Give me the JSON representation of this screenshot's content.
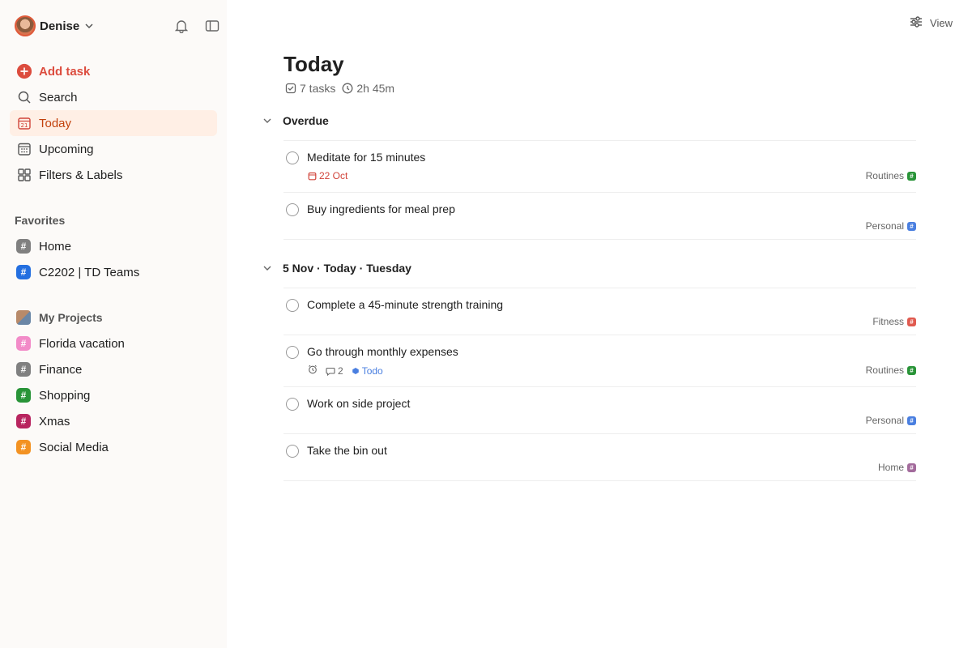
{
  "user": {
    "name": "Denise"
  },
  "nav": [
    {
      "key": "add",
      "label": "Add task",
      "icon": "plus-circle-icon"
    },
    {
      "key": "search",
      "label": "Search",
      "icon": "search-icon"
    },
    {
      "key": "today",
      "label": "Today",
      "icon": "calendar-today-icon",
      "badge": "21"
    },
    {
      "key": "upcoming",
      "label": "Upcoming",
      "icon": "calendar-grid-icon"
    },
    {
      "key": "filters",
      "label": "Filters & Labels",
      "icon": "grid-icon"
    }
  ],
  "favorites": {
    "label": "Favorites",
    "items": [
      {
        "label": "Home",
        "color": "#808080"
      },
      {
        "label": "C2202 | TD Teams",
        "color": "#246fe0"
      }
    ]
  },
  "projects": {
    "label": "My Projects",
    "items": [
      {
        "label": "Florida vacation",
        "color": "#f28bc8"
      },
      {
        "label": "Finance",
        "color": "#808080"
      },
      {
        "label": "Shopping",
        "color": "#299438"
      },
      {
        "label": "Xmas",
        "color": "#b8255f"
      },
      {
        "label": "Social Media",
        "color": "#f39222"
      }
    ]
  },
  "header": {
    "view_label": "View",
    "title": "Today",
    "task_count": "7 tasks",
    "duration": "2h 45m"
  },
  "groups": [
    {
      "title": "Overdue"
    },
    {
      "title": "5 Nov · Today · Tuesday"
    }
  ],
  "tasks": [
    {
      "title": "Meditate for 15 minutes",
      "due": "22 Oct",
      "project": "Routines",
      "project_color": "#299438"
    },
    {
      "title": "Buy ingredients for meal prep",
      "project": "Personal",
      "project_color": "#4a7fe0"
    },
    {
      "title": "Complete a 45-minute strength training",
      "project": "Fitness",
      "project_color": "#e05a4f"
    },
    {
      "title": "Go through monthly expenses",
      "comments": "2",
      "label": "Todo",
      "project": "Routines",
      "project_color": "#299438"
    },
    {
      "title": "Work on side project",
      "project": "Personal",
      "project_color": "#4a7fe0"
    },
    {
      "title": "Take the bin out",
      "project": "Home",
      "project_color": "#a36b9c"
    }
  ],
  "colors": {
    "accent": "#dc4c3e",
    "active_bg": "#ffefe5",
    "active_text": "#c2410c"
  }
}
